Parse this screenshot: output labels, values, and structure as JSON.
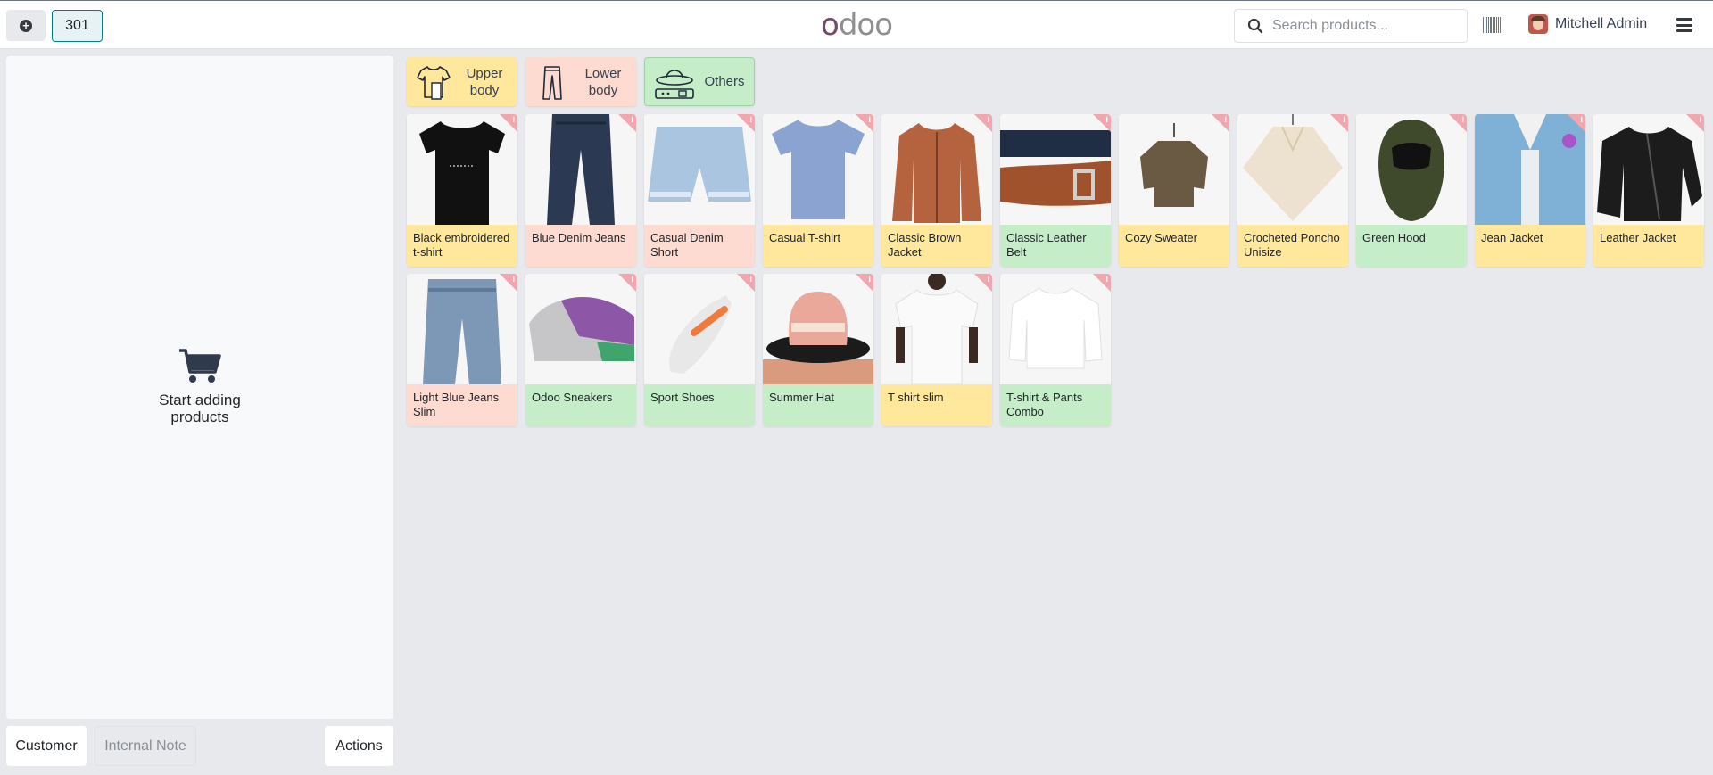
{
  "topbar": {
    "order_number": "301",
    "logo": "odoo",
    "search_placeholder": "Search products...",
    "user_name": "Mitchell Admin"
  },
  "cart": {
    "empty_text": "Start adding products"
  },
  "bottom": {
    "customer": "Customer",
    "internal_note": "Internal Note",
    "actions": "Actions"
  },
  "categories": [
    {
      "label": "Upper body",
      "icon": "tshirt-icon",
      "color": "#ffe79c"
    },
    {
      "label": "Lower body",
      "icon": "pants-icon",
      "color": "#fddbd1"
    },
    {
      "label": "Others",
      "icon": "hat-belt-icon",
      "color": "#c4edc8"
    }
  ],
  "products": [
    {
      "name": "Black embroidered t-shirt",
      "category": "upper",
      "icon": "black-tshirt-image"
    },
    {
      "name": "Blue Denim Jeans",
      "category": "lower",
      "icon": "jeans-image"
    },
    {
      "name": "Casual Denim Short",
      "category": "lower",
      "icon": "shorts-image"
    },
    {
      "name": "Casual T-shirt",
      "category": "upper",
      "icon": "blue-tshirt-image"
    },
    {
      "name": "Classic Brown Jacket",
      "category": "upper",
      "icon": "brown-jacket-image"
    },
    {
      "name": "Classic Leather Belt",
      "category": "others",
      "icon": "belt-image"
    },
    {
      "name": "Cozy Sweater",
      "category": "upper",
      "icon": "sweater-image"
    },
    {
      "name": "Crocheted Poncho Unisize",
      "category": "upper",
      "icon": "poncho-image"
    },
    {
      "name": "Green Hood",
      "category": "others",
      "icon": "hood-image"
    },
    {
      "name": "Jean Jacket",
      "category": "upper",
      "icon": "jean-jacket-image"
    },
    {
      "name": "Leather Jacket",
      "category": "upper",
      "icon": "leather-jacket-image"
    },
    {
      "name": "Light Blue Jeans Slim",
      "category": "lower",
      "icon": "light-jeans-image"
    },
    {
      "name": "Odoo Sneakers",
      "category": "others",
      "icon": "sneakers-image"
    },
    {
      "name": "Sport Shoes",
      "category": "others",
      "icon": "sport-shoes-image"
    },
    {
      "name": "Summer Hat",
      "category": "others",
      "icon": "hat-image"
    },
    {
      "name": "T shirt slim",
      "category": "upper",
      "icon": "white-tshirt-image"
    },
    {
      "name": "T-shirt & Pants Combo",
      "category": "others",
      "icon": "sweatshirt-image"
    }
  ],
  "colors": {
    "upper": "#ffe79c",
    "lower": "#fddbd1",
    "others": "#c4edc8",
    "brand": "#714b67",
    "accent": "#017e84"
  }
}
